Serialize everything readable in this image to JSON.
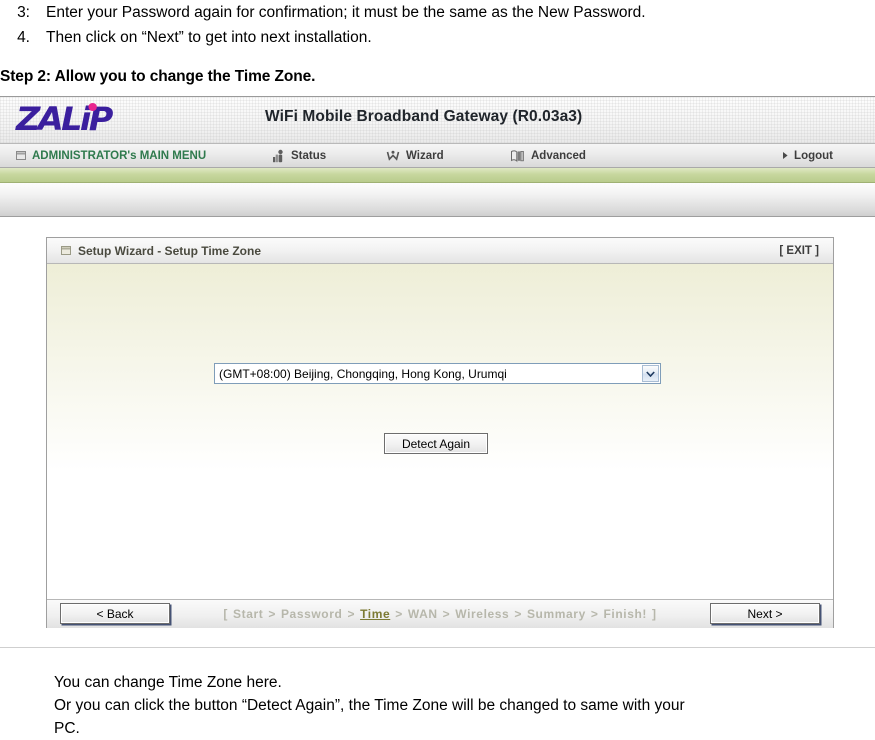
{
  "document": {
    "list_items": [
      {
        "number": "3:",
        "text": "Enter your Password again for confirmation; it must be the same as the New Password."
      },
      {
        "number": "4.",
        "text": "Then click on “Next” to get into next installation."
      }
    ],
    "step_heading": "Step 2: Allow you to change the Time Zone.",
    "caption_lines": [
      "You can change Time Zone here.",
      "Or you can click the button “Detect Again”, the Time Zone will be changed to same with your",
      "PC."
    ]
  },
  "screenshot": {
    "brand": {
      "logo_text": "ZALiP",
      "title": "WiFi Mobile Broadband Gateway (R0.03a3)"
    },
    "nav": {
      "admin_label": "ADMINISTRATOR's MAIN MENU",
      "items": [
        {
          "label": "Status",
          "icon": "status-person-icon"
        },
        {
          "label": "Wizard",
          "icon": "wizard-hat-icon"
        },
        {
          "label": "Advanced",
          "icon": "advanced-book-icon"
        }
      ],
      "logout_label": "Logout",
      "logout_icon": "arrow-right-icon"
    },
    "panel": {
      "title": "Setup Wizard - Setup Time Zone",
      "title_icon": "window-icon",
      "exit_label": "[ EXIT ]",
      "timezone": {
        "selected": "(GMT+08:00) Beijing, Chongqing, Hong Kong, Urumqi",
        "options": [
          "(GMT+08:00) Beijing, Chongqing, Hong Kong, Urumqi"
        ]
      },
      "detect_button": "Detect Again",
      "footer": {
        "back_button": "< Back",
        "next_button": "Next >",
        "breadcrumb_open": "[",
        "breadcrumb_close": "]",
        "breadcrumb_separator": ">",
        "breadcrumb_steps": [
          {
            "label": "Start",
            "active": false
          },
          {
            "label": "Password",
            "active": false
          },
          {
            "label": "Time",
            "active": true
          },
          {
            "label": "WAN",
            "active": false
          },
          {
            "label": "Wireless",
            "active": false
          },
          {
            "label": "Summary",
            "active": false
          },
          {
            "label": "Finish!",
            "active": false
          }
        ]
      }
    }
  },
  "colors": {
    "logo_purple": "#3b1f9e",
    "logo_dot_pink": "#e8268f",
    "admin_green": "#2f7a4d",
    "green_strip": "#c7d79e",
    "panel_cream": "#eeeed7",
    "breadcrumb_inactive": "#b7b7ab",
    "breadcrumb_active": "#7c7a33"
  }
}
